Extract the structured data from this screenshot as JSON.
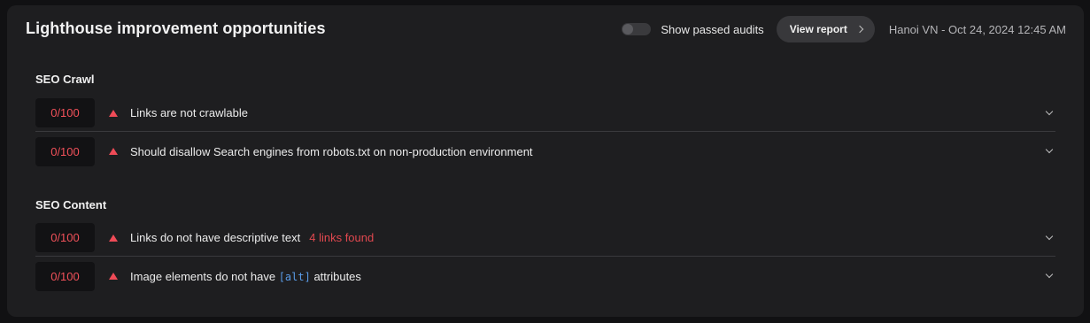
{
  "header": {
    "title": "Lighthouse improvement opportunities",
    "toggle_label": "Show passed audits",
    "view_report_label": "View report",
    "meta": "Hanoi VN - Oct 24, 2024 12:45 AM"
  },
  "sections": [
    {
      "title": "SEO Crawl",
      "items": [
        {
          "score": "0/100",
          "label": "Links are not crawlable"
        },
        {
          "score": "0/100",
          "label": "Should disallow Search engines from robots.txt on non-production environment"
        }
      ]
    },
    {
      "title": "SEO Content",
      "items": [
        {
          "score": "0/100",
          "label": "Links do not have descriptive text",
          "extra": "4 links found"
        },
        {
          "score": "0/100",
          "label_prefix": "Image elements do not have",
          "code": "[alt]",
          "label_suffix": "attributes"
        }
      ]
    }
  ],
  "colors": {
    "score": "#f2515a",
    "warning": "#ef4b57",
    "code": "#5a9be6",
    "card_bg": "#1e1e20"
  },
  "icons": {
    "warning": "warning-triangle-icon",
    "expand": "chevron-down-icon",
    "view_report": "chevron-right-icon"
  }
}
